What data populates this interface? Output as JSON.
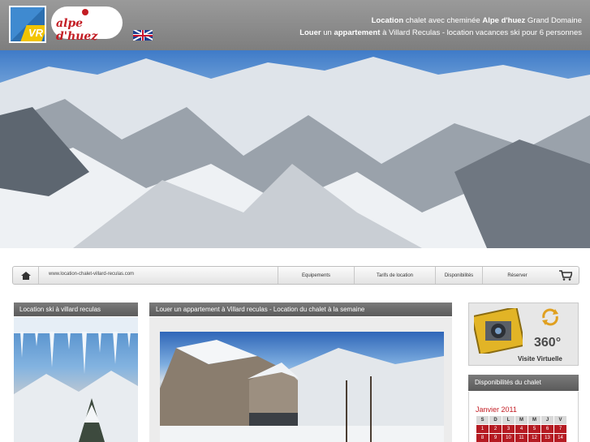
{
  "header": {
    "logo_vr_text": "VR",
    "logo_alpe_text": "alpe d'huez",
    "tagline_line1": {
      "b1": "Location",
      "t1": " chalet avec cheminée ",
      "b2": "Alpe d'huez",
      "t2": " Grand Domaine"
    },
    "tagline_line2": {
      "b1": "Louer",
      "t1": " un ",
      "b2": "appartement",
      "t2": " à Villard Reculas - location vacances ski pour 6 personnes"
    }
  },
  "nav": {
    "url": "www.location-chalet-villard-reculas.com",
    "items": [
      "Equipements",
      "Tarifs de location",
      "Disponibilités",
      "Réserver"
    ]
  },
  "left": {
    "title": "Location ski à villard reculas"
  },
  "center": {
    "title": "Louer un appartement à Villard reculas - Location du chalet à la semaine"
  },
  "right": {
    "tour_360": "360°",
    "tour_label": "Visite Virtuelle",
    "dispo_title": "Disponibilités du chalet",
    "calendar": {
      "month": "Janvier 2011",
      "days": [
        "S",
        "D",
        "L",
        "M",
        "M",
        "J",
        "V"
      ],
      "row1": [
        "1",
        "2",
        "3",
        "4",
        "5",
        "6",
        "7"
      ],
      "row2": [
        "8",
        "9",
        "10",
        "11",
        "12",
        "13",
        "14"
      ]
    }
  },
  "colors": {
    "header_gray": "#8a8a8a",
    "panel_header": "#666666",
    "calendar_red": "#b51b22"
  }
}
